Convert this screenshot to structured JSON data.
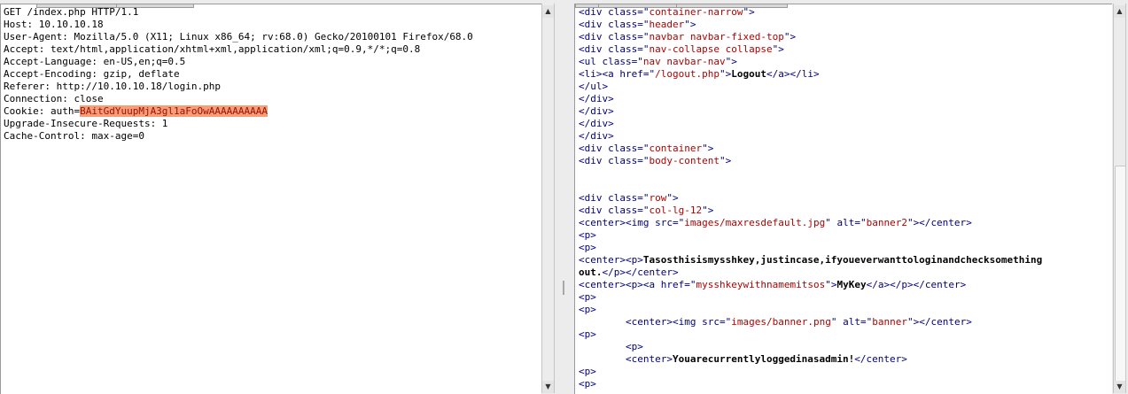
{
  "request": {
    "lines": [
      "GET /index.php HTTP/1.1",
      "Host: 10.10.10.18",
      "User-Agent: Mozilla/5.0 (X11; Linux x86_64; rv:68.0) Gecko/20100101 Firefox/68.0",
      "Accept: text/html,application/xhtml+xml,application/xml;q=0.9,*/*;q=0.8",
      "Accept-Language: en-US,en;q=0.5",
      "Accept-Encoding: gzip, deflate",
      "Referer: http://10.10.10.18/login.php",
      "Connection: close"
    ],
    "cookie_prefix": "Cookie: auth=",
    "cookie_value": "BAitGdYuupMjA3gl1aFoOwAAAAAAAAAA",
    "lines_after": [
      "Upgrade-Insecure-Requests: 1",
      "Cache-Control: max-age=0"
    ]
  },
  "response": {
    "l1": {
      "t": "div",
      "a": "class",
      "v": "container-narrow"
    },
    "l2": {
      "t": "div",
      "a": "class",
      "v": "header"
    },
    "l3": {
      "t": "div",
      "a": "class",
      "v": "navbar navbar-fixed-top"
    },
    "l4": {
      "t": "div",
      "a": "class",
      "v": "nav-collapse collapse"
    },
    "l5": {
      "t": "ul",
      "a": "class",
      "v": "nav navbar-nav"
    },
    "l6": {
      "li": "li",
      "t": "a",
      "a": "href",
      "v": "/logout.php",
      "text": "Logout"
    },
    "l7": "ul",
    "l8": "div",
    "l9": "div",
    "l10": "div",
    "l11": "div",
    "l12": {
      "t": "div",
      "a": "class",
      "v": "container"
    },
    "l13": {
      "t": "div",
      "a": "class",
      "v": "body-content"
    },
    "l16": {
      "t": "div",
      "a": "class",
      "v": "row"
    },
    "l17": {
      "t": "div",
      "a": "class",
      "v": "col-lg-12"
    },
    "l18": {
      "c": "center",
      "t": "img",
      "a1": "src",
      "v1": "images/maxresdefault.jpg",
      "a2": "alt",
      "v2": "banner2"
    },
    "l19": "p",
    "l20": "p",
    "l21": {
      "c": "center",
      "p": "p",
      "text": "Tasosthisismysshkey,justincase,ifyoueverwanttologinandchecksomething"
    },
    "l22": {
      "text": "out.",
      "p": "p",
      "c": "center"
    },
    "l23": {
      "c": "center",
      "p": "p",
      "t": "a",
      "a": "href",
      "v": "mysshkeywithnamemitsos",
      "text": "MyKey"
    },
    "l24": "p",
    "l25": "p",
    "l26": {
      "indent": "        ",
      "c": "center",
      "t": "img",
      "a1": "src",
      "v1": "images/banner.png",
      "a2": "alt",
      "v2": "banner"
    },
    "l27": "p",
    "l28": {
      "indent": "        ",
      "t": "p"
    },
    "l29": {
      "indent": "        ",
      "c": "center",
      "text": "Youarecurrentlyloggedinasadmin!"
    },
    "l30": "p",
    "l31": "p"
  },
  "scrollbar_up_icon": "triangle-up",
  "scrollbar_down_icon": "triangle-down"
}
